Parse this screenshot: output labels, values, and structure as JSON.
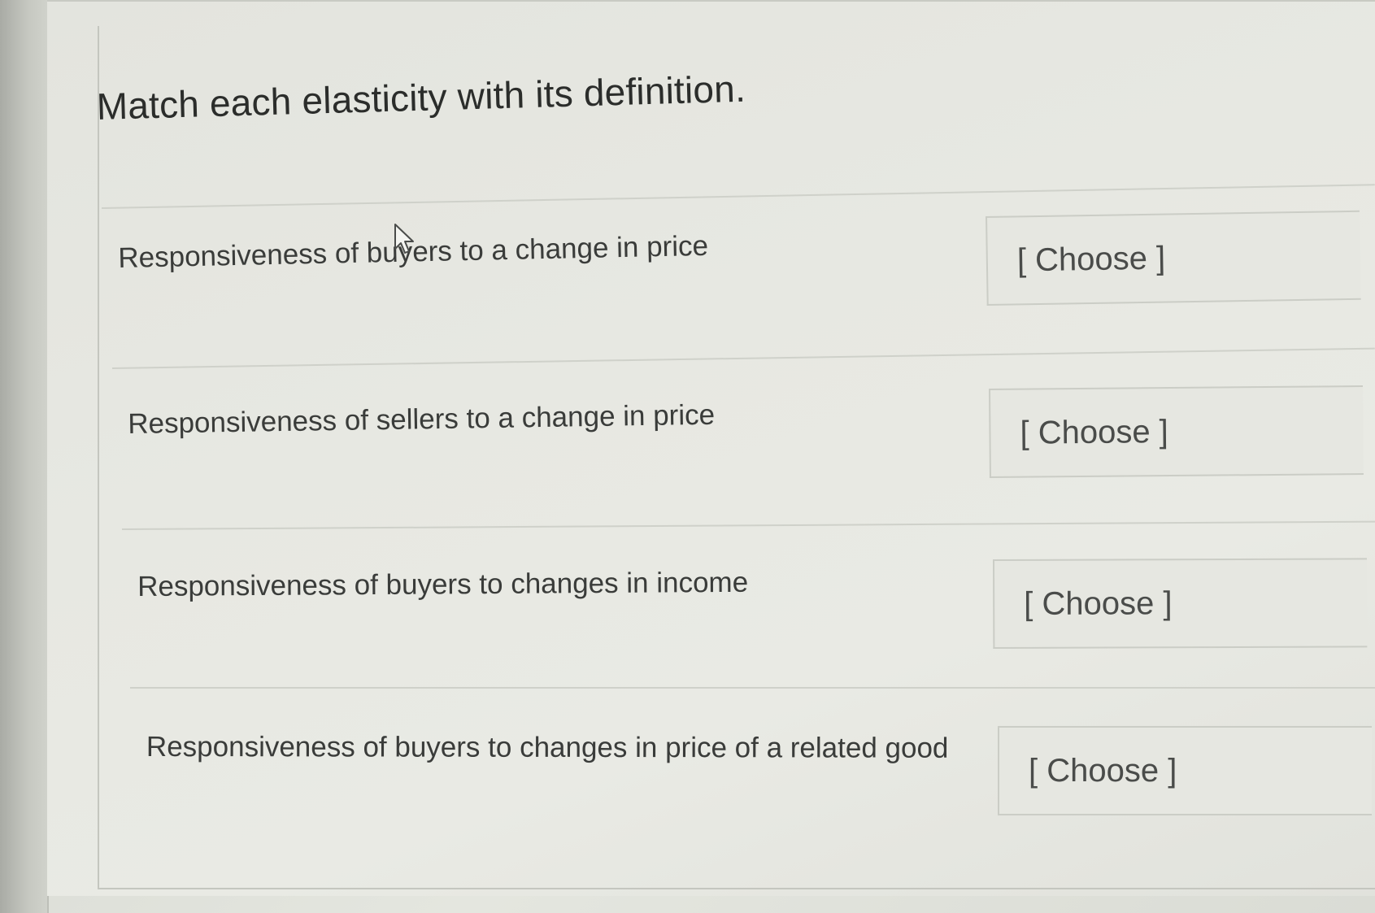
{
  "question": {
    "title": "Match each elasticity with its definition."
  },
  "rows": [
    {
      "prompt": "Responsiveness of buyers to a change in price",
      "select_value": "[ Choose ]"
    },
    {
      "prompt": "Responsiveness of sellers to a change in price",
      "select_value": "[ Choose ]"
    },
    {
      "prompt": "Responsiveness of buyers to changes in income",
      "select_value": "[ Choose ]"
    },
    {
      "prompt": "Responsiveness of buyers to changes in price of a related good",
      "select_value": "[ Choose ]"
    }
  ],
  "icons": {
    "cursor": "pointer-arrow-icon"
  }
}
